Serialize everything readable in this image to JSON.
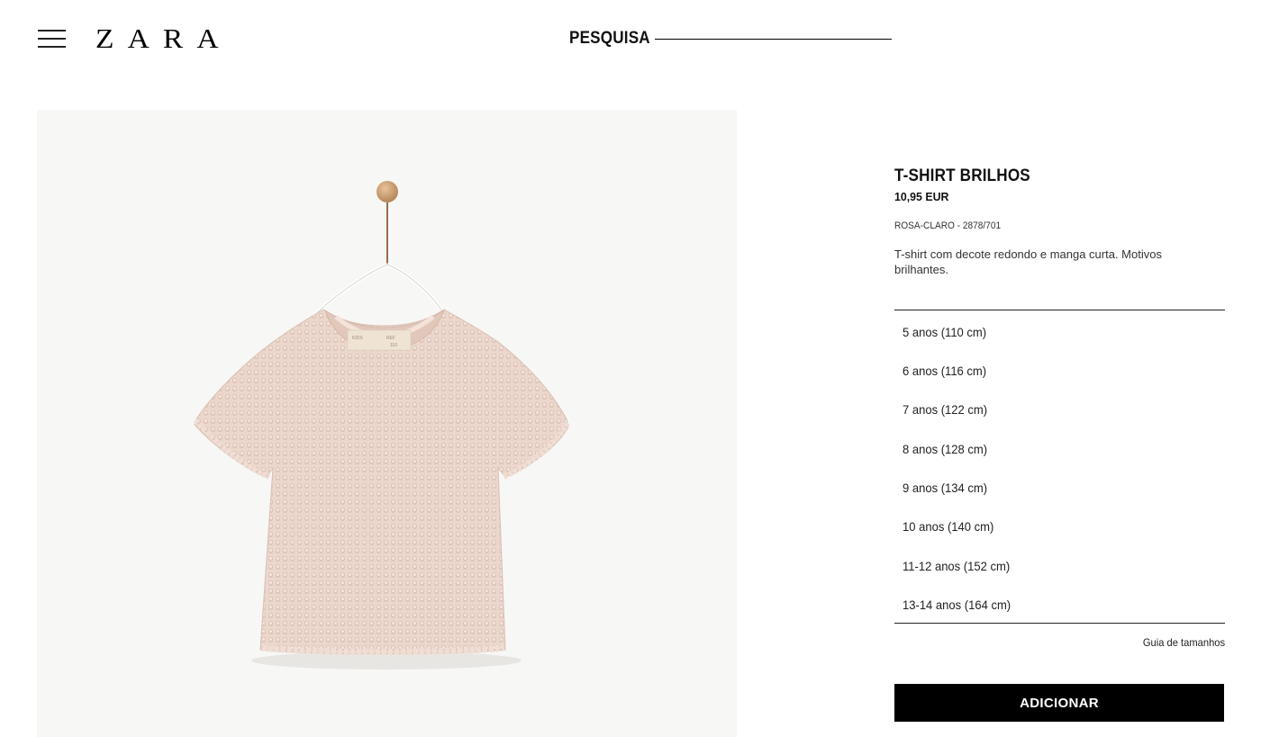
{
  "header": {
    "logo": "ZARA",
    "search_label": "PESQUISA"
  },
  "product": {
    "name": "T-SHIRT BRILHOS",
    "price": "10,95 EUR",
    "reference": "ROSA-CLARO - 2878/701",
    "description": "T-shirt com decote redondo e manga curta. Motivos brilhantes.",
    "image_alt": "pink-tshirt-on-hanger",
    "tag_lines": [
      "KIDS",
      "REF",
      "110"
    ],
    "colors": {
      "shirt": "#ecd7cd",
      "background": "#f7f7f6"
    }
  },
  "sizes": [
    "5 anos (110 cm)",
    "6 anos (116 cm)",
    "7 anos (122 cm)",
    "8 anos (128 cm)",
    "9 anos (134 cm)",
    "10 anos (140 cm)",
    "11-12 anos (152 cm)",
    "13-14 anos (164 cm)"
  ],
  "size_guide_label": "Guia de tamanhos",
  "add_button_label": "ADICIONAR"
}
